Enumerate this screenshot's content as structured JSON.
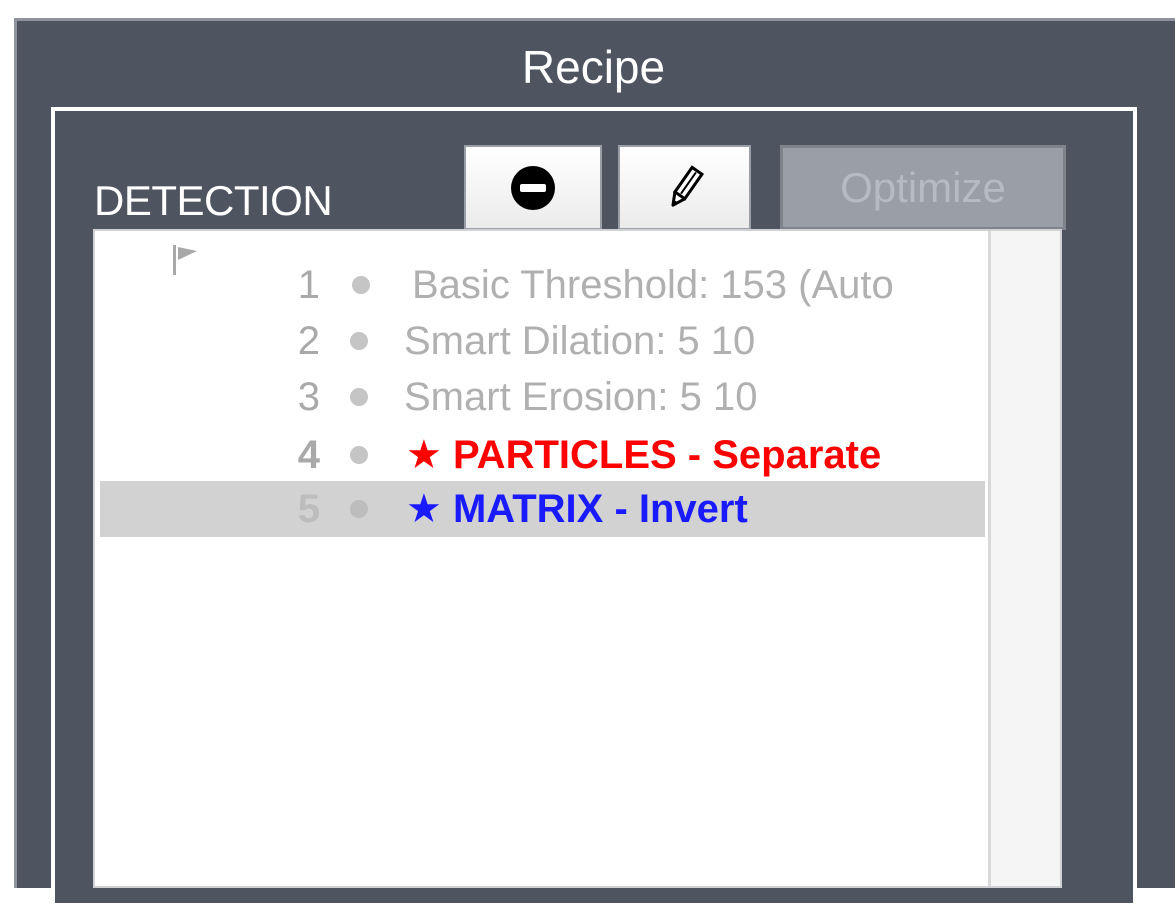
{
  "panel": {
    "title": "Recipe"
  },
  "section": {
    "label": "DETECTION"
  },
  "toolbar": {
    "remove_icon": "remove-icon",
    "edit_icon": "pencil-icon",
    "optimize_label": "Optimize"
  },
  "steps": [
    {
      "number": "1",
      "text": "Basic Threshold: 153 (Auto",
      "color": "#b0b0b0",
      "starred": false,
      "flagged": true
    },
    {
      "number": "2",
      "text": "Smart Dilation: 5 10",
      "color": "#b0b0b0",
      "starred": false,
      "flagged": false
    },
    {
      "number": "3",
      "text": "Smart Erosion: 5 10",
      "color": "#b0b0b0",
      "starred": false,
      "flagged": false
    },
    {
      "number": "4",
      "text": "★ PARTICLES - Separate",
      "color": "#ff0000",
      "starred": true,
      "flagged": false
    },
    {
      "number": "5",
      "text": "★ MATRIX - Invert",
      "color": "#1a1aff",
      "starred": true,
      "flagged": false,
      "selected": true
    }
  ]
}
